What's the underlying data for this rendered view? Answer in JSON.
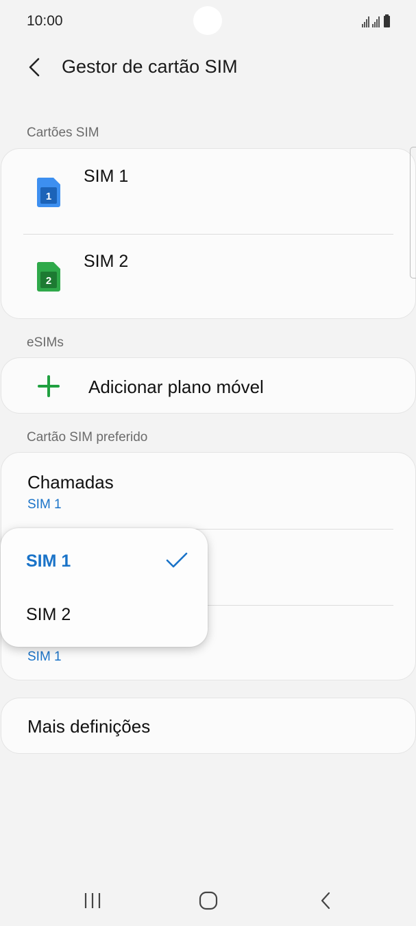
{
  "status_bar": {
    "time": "10:00"
  },
  "header": {
    "title": "Gestor de cartão SIM"
  },
  "sim_section": {
    "label": "Cartões SIM",
    "cards": [
      {
        "name": "SIM 1",
        "number": "1",
        "color": "#3d8ff0"
      },
      {
        "name": "SIM 2",
        "number": "2",
        "color": "#2fa94a"
      }
    ]
  },
  "esim_section": {
    "label": "eSIMs",
    "add_label": "Adicionar plano móvel"
  },
  "preferred_section": {
    "label": "Cartão SIM preferido",
    "rows": [
      {
        "title": "Chamadas",
        "value": "SIM 1"
      },
      {
        "title": "",
        "value": ""
      },
      {
        "title": "",
        "value": "SIM 1"
      }
    ]
  },
  "more": {
    "label": "Mais definições"
  },
  "dropdown": {
    "options": [
      {
        "label": "SIM 1",
        "selected": true
      },
      {
        "label": "SIM 2",
        "selected": false
      }
    ]
  },
  "colors": {
    "accent": "#1a73c8",
    "add_green": "#20a040"
  },
  "icons": [
    "back-arrow-icon",
    "sim-card-icon",
    "plus-icon",
    "check-icon",
    "recents-icon",
    "home-icon",
    "back-icon"
  ]
}
